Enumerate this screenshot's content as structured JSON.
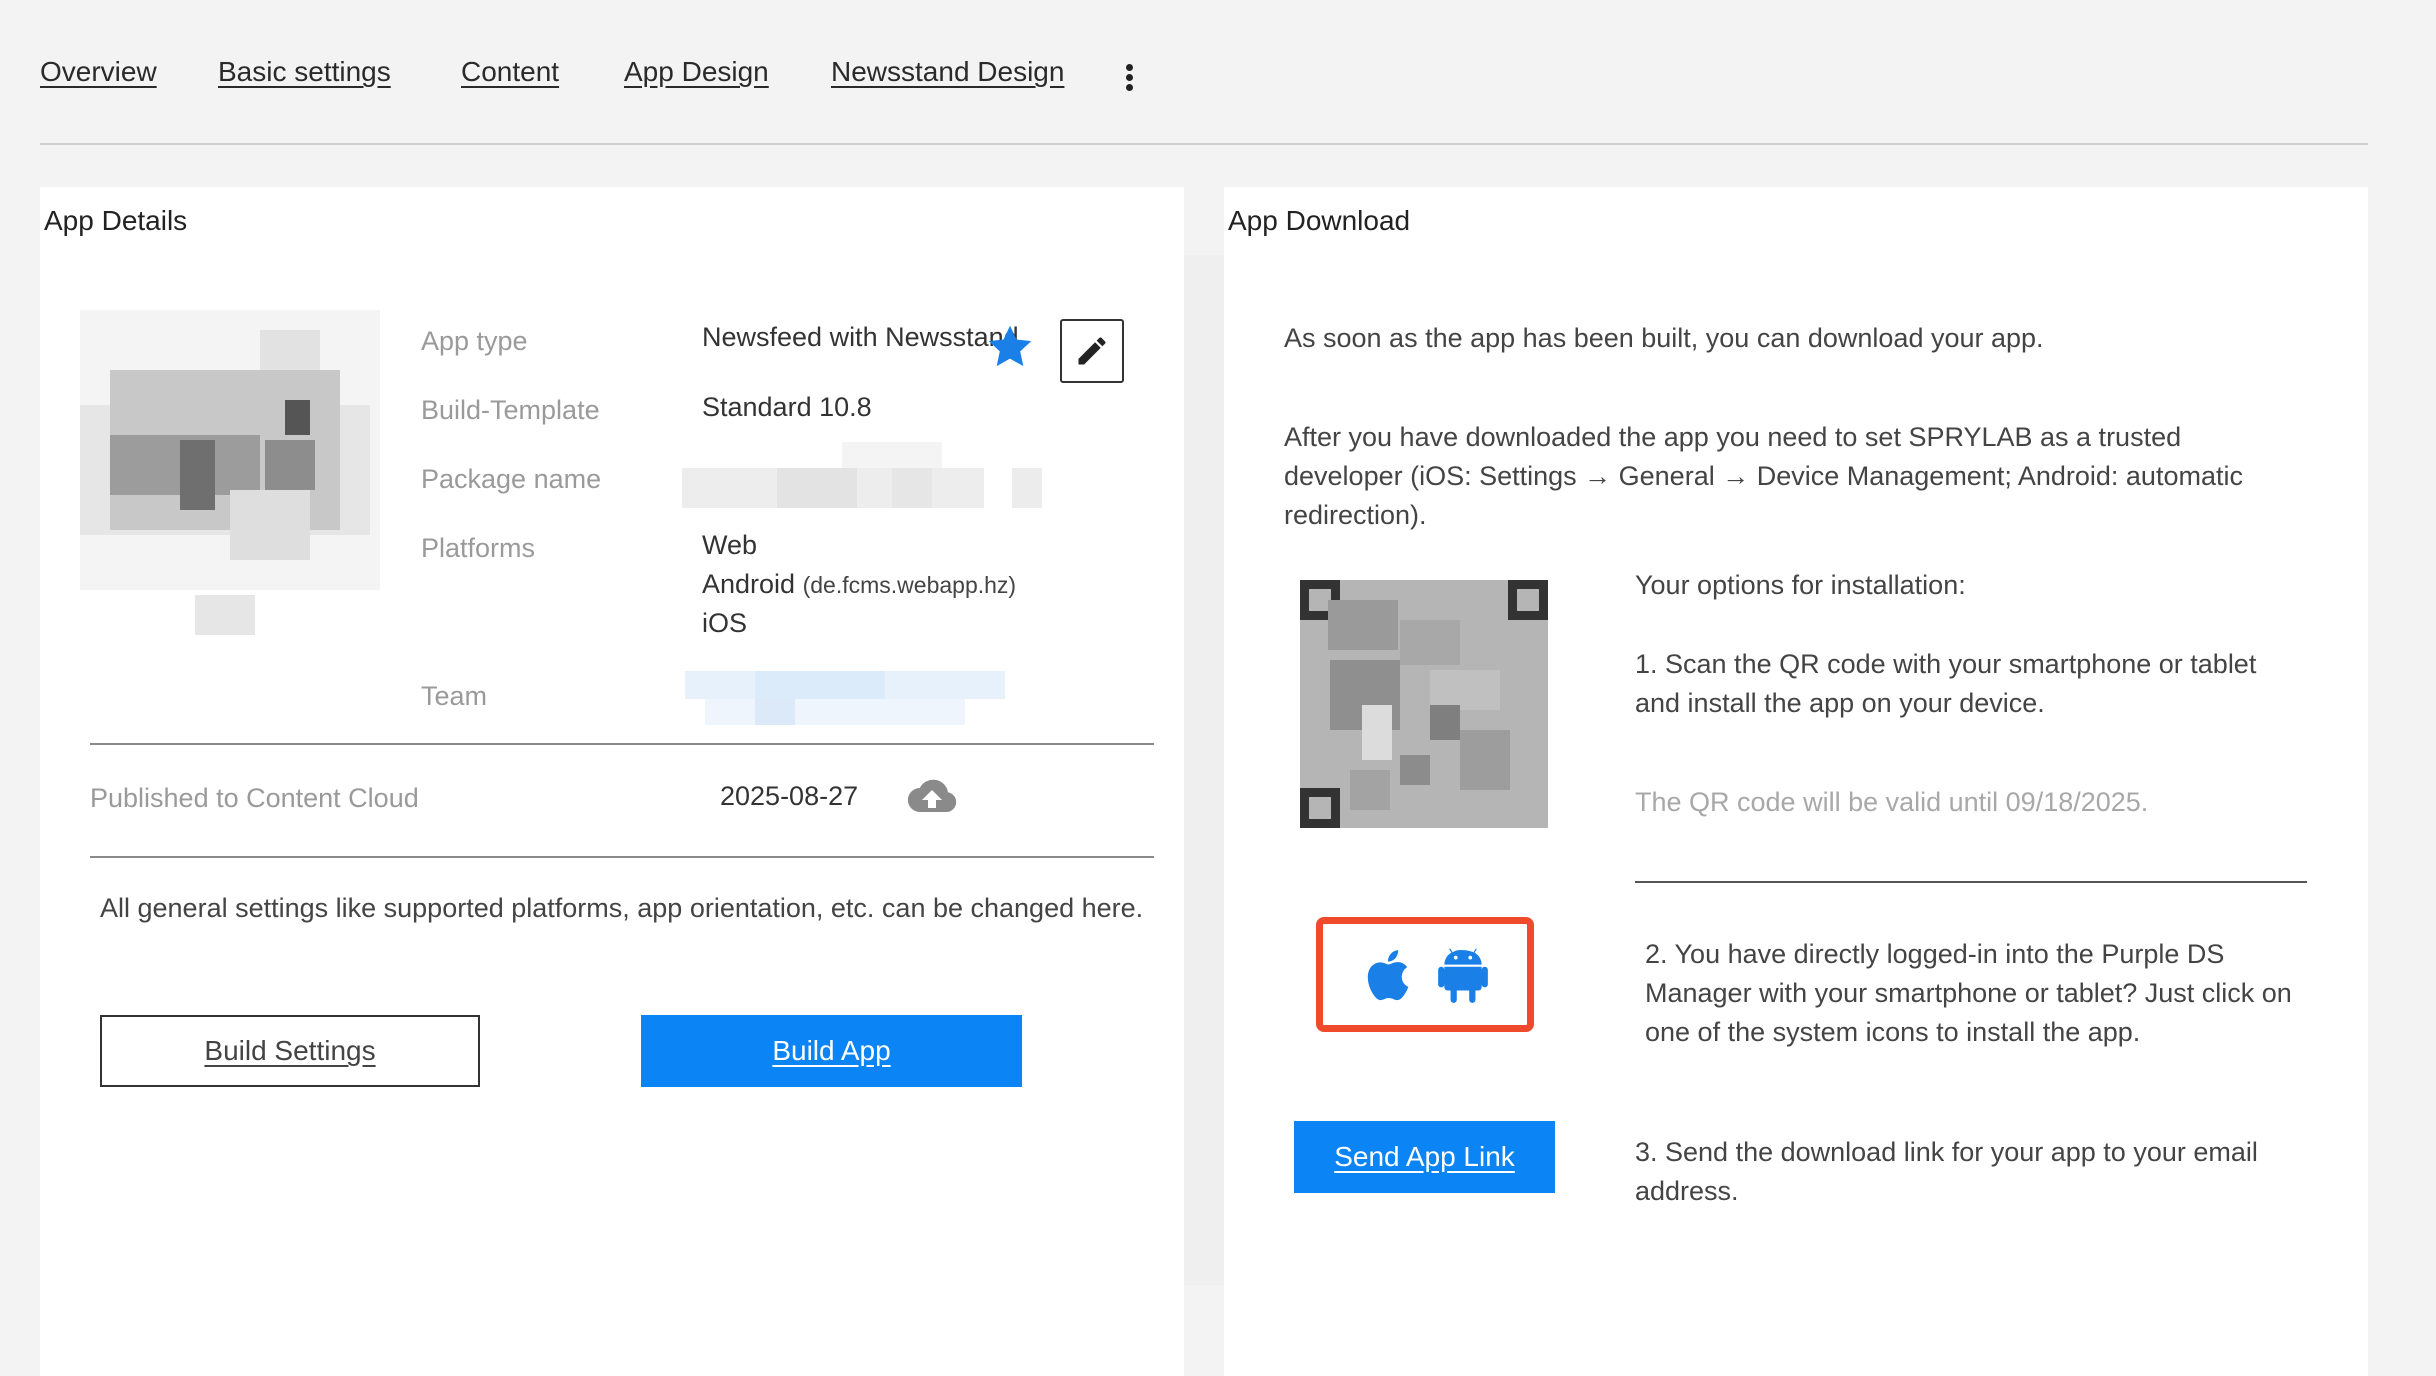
{
  "nav": {
    "tabs": [
      "Overview",
      "Basic settings",
      "Content",
      "App Design",
      "Newsstand Design"
    ]
  },
  "app_details": {
    "title": "App Details",
    "fields": {
      "app_type_label": "App type",
      "app_type_value": "Newsfeed with Newsstand",
      "build_template_label": "Build-Template",
      "build_template_value": "Standard 10.8",
      "package_name_label": "Package name",
      "platforms_label": "Platforms",
      "platform_web": "Web",
      "platform_android": "Android",
      "platform_android_id": "(de.fcms.webapp.hz)",
      "platform_ios": "iOS",
      "team_label": "Team"
    },
    "published_label": "Published to Content Cloud",
    "published_date": "2025-08-27",
    "settings_note": "All general settings like supported platforms, app orientation, etc. can be changed here.",
    "build_settings_label": "Build Settings",
    "build_app_label": "Build App"
  },
  "app_download": {
    "title": "App Download",
    "intro": "As soon as the app has been built, you can download your app.",
    "trusted_note": "After you have downloaded the app you need to set SPRYLAB as a trusted developer (iOS: Settings → General → Device Management; Android: automatic redirection).",
    "options_heading": "Your options for installation:",
    "option_1": "1. Scan the QR code with your smartphone or tablet and install the app on your device.",
    "qr_valid": "The QR code will be valid until 09/18/2025.",
    "option_2": "2. You have directly logged-in into the Purple DS Manager with your smartphone or tablet? Just click on one of the system icons to install the app.",
    "option_3": "3. Send the download link for your app to your email address.",
    "send_link_label": "Send App Link"
  },
  "colors": {
    "accent_blue": "#0b85f5",
    "highlight_red": "#f04a2c"
  },
  "icons": [
    "more-vertical-icon",
    "star-icon",
    "pencil-icon",
    "cloud-upload-icon",
    "apple-icon",
    "android-icon"
  ]
}
